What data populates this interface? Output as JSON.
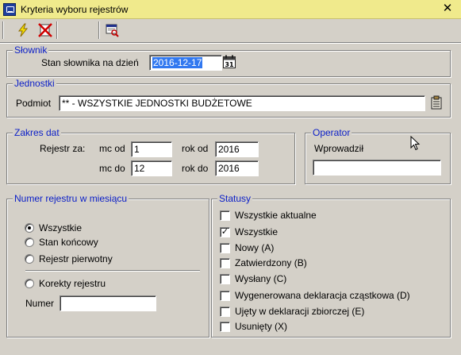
{
  "window": {
    "title": "Kryteria wyboru rejestrów",
    "app_icon": "app-window-icon",
    "close_glyph": "✕"
  },
  "toolbar": {
    "items": [
      "lightning-icon",
      "cancel-x-icon",
      "print-preview-icon"
    ]
  },
  "slownik": {
    "title": "Słownik",
    "label": "Stan słownika na dzień",
    "date_value": "2016-12-17",
    "calendar_icon": "calendar-icon",
    "calendar_text": "31"
  },
  "jednostki": {
    "title": "Jednostki",
    "label": "Podmiot",
    "value": "** - WSZYSTKIE JEDNOSTKI BUDŻETOWE",
    "picker_icon": "clipboard-icon"
  },
  "zakres": {
    "title": "Zakres dat",
    "rejestr_label": "Rejestr za:",
    "mc_od_label": "mc od",
    "mc_od_value": "1",
    "mc_do_label": "mc do",
    "mc_do_value": "12",
    "rok_od_label": "rok od",
    "rok_od_value": "2016",
    "rok_do_label": "rok do",
    "rok_do_value": "2016"
  },
  "operator": {
    "title": "Operator",
    "label": "Wprowadził",
    "value": ""
  },
  "numer_rejestru": {
    "title": "Numer rejestru w miesiącu",
    "options": [
      {
        "label": "Wszystkie",
        "selected": true
      },
      {
        "label": "Stan końcowy",
        "selected": false
      },
      {
        "label": "Rejestr pierwotny",
        "selected": false
      }
    ],
    "korekty_label": "Korekty rejestru",
    "korekty_selected": false,
    "numer_label": "Numer",
    "numer_value": ""
  },
  "statusy": {
    "title": "Statusy",
    "items": [
      {
        "label": "Wszystkie aktualne",
        "checked": false
      },
      {
        "label": "Wszystkie",
        "checked": true
      },
      {
        "label": "Nowy (A)",
        "checked": false
      },
      {
        "label": "Zatwierdzony (B)",
        "checked": false
      },
      {
        "label": "Wysłany (C)",
        "checked": false
      },
      {
        "label": "Wygenerowana deklaracja cząstkowa (D)",
        "checked": false
      },
      {
        "label": "Ujęty w deklaracji zbiorczej (E)",
        "checked": false
      },
      {
        "label": "Usunięty (X)",
        "checked": false
      }
    ]
  },
  "colors": {
    "titlebar": "#f0ea8c",
    "group_title": "#0a1ec8",
    "selection": "#3178f0",
    "face": "#d4d0c8"
  }
}
